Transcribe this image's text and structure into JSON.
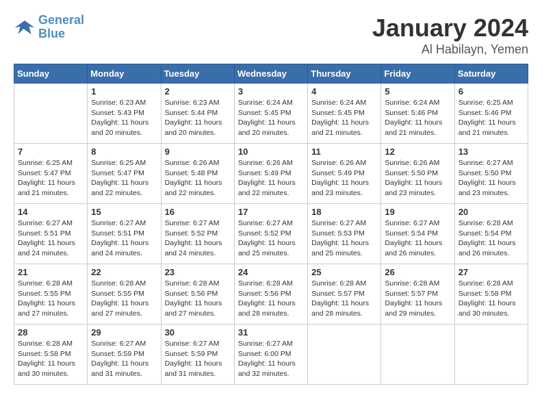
{
  "header": {
    "logo_line1": "General",
    "logo_line2": "Blue",
    "title": "January 2024",
    "subtitle": "Al Habilayn, Yemen"
  },
  "weekdays": [
    "Sunday",
    "Monday",
    "Tuesday",
    "Wednesday",
    "Thursday",
    "Friday",
    "Saturday"
  ],
  "weeks": [
    [
      {
        "day": "",
        "sunrise": "",
        "sunset": "",
        "daylight": ""
      },
      {
        "day": "1",
        "sunrise": "Sunrise: 6:23 AM",
        "sunset": "Sunset: 5:43 PM",
        "daylight": "Daylight: 11 hours and 20 minutes."
      },
      {
        "day": "2",
        "sunrise": "Sunrise: 6:23 AM",
        "sunset": "Sunset: 5:44 PM",
        "daylight": "Daylight: 11 hours and 20 minutes."
      },
      {
        "day": "3",
        "sunrise": "Sunrise: 6:24 AM",
        "sunset": "Sunset: 5:45 PM",
        "daylight": "Daylight: 11 hours and 20 minutes."
      },
      {
        "day": "4",
        "sunrise": "Sunrise: 6:24 AM",
        "sunset": "Sunset: 5:45 PM",
        "daylight": "Daylight: 11 hours and 21 minutes."
      },
      {
        "day": "5",
        "sunrise": "Sunrise: 6:24 AM",
        "sunset": "Sunset: 5:46 PM",
        "daylight": "Daylight: 11 hours and 21 minutes."
      },
      {
        "day": "6",
        "sunrise": "Sunrise: 6:25 AM",
        "sunset": "Sunset: 5:46 PM",
        "daylight": "Daylight: 11 hours and 21 minutes."
      }
    ],
    [
      {
        "day": "7",
        "sunrise": "Sunrise: 6:25 AM",
        "sunset": "Sunset: 5:47 PM",
        "daylight": "Daylight: 11 hours and 21 minutes."
      },
      {
        "day": "8",
        "sunrise": "Sunrise: 6:25 AM",
        "sunset": "Sunset: 5:47 PM",
        "daylight": "Daylight: 11 hours and 22 minutes."
      },
      {
        "day": "9",
        "sunrise": "Sunrise: 6:26 AM",
        "sunset": "Sunset: 5:48 PM",
        "daylight": "Daylight: 11 hours and 22 minutes."
      },
      {
        "day": "10",
        "sunrise": "Sunrise: 6:26 AM",
        "sunset": "Sunset: 5:49 PM",
        "daylight": "Daylight: 11 hours and 22 minutes."
      },
      {
        "day": "11",
        "sunrise": "Sunrise: 6:26 AM",
        "sunset": "Sunset: 5:49 PM",
        "daylight": "Daylight: 11 hours and 23 minutes."
      },
      {
        "day": "12",
        "sunrise": "Sunrise: 6:26 AM",
        "sunset": "Sunset: 5:50 PM",
        "daylight": "Daylight: 11 hours and 23 minutes."
      },
      {
        "day": "13",
        "sunrise": "Sunrise: 6:27 AM",
        "sunset": "Sunset: 5:50 PM",
        "daylight": "Daylight: 11 hours and 23 minutes."
      }
    ],
    [
      {
        "day": "14",
        "sunrise": "Sunrise: 6:27 AM",
        "sunset": "Sunset: 5:51 PM",
        "daylight": "Daylight: 11 hours and 24 minutes."
      },
      {
        "day": "15",
        "sunrise": "Sunrise: 6:27 AM",
        "sunset": "Sunset: 5:51 PM",
        "daylight": "Daylight: 11 hours and 24 minutes."
      },
      {
        "day": "16",
        "sunrise": "Sunrise: 6:27 AM",
        "sunset": "Sunset: 5:52 PM",
        "daylight": "Daylight: 11 hours and 24 minutes."
      },
      {
        "day": "17",
        "sunrise": "Sunrise: 6:27 AM",
        "sunset": "Sunset: 5:52 PM",
        "daylight": "Daylight: 11 hours and 25 minutes."
      },
      {
        "day": "18",
        "sunrise": "Sunrise: 6:27 AM",
        "sunset": "Sunset: 5:53 PM",
        "daylight": "Daylight: 11 hours and 25 minutes."
      },
      {
        "day": "19",
        "sunrise": "Sunrise: 6:27 AM",
        "sunset": "Sunset: 5:54 PM",
        "daylight": "Daylight: 11 hours and 26 minutes."
      },
      {
        "day": "20",
        "sunrise": "Sunrise: 6:28 AM",
        "sunset": "Sunset: 5:54 PM",
        "daylight": "Daylight: 11 hours and 26 minutes."
      }
    ],
    [
      {
        "day": "21",
        "sunrise": "Sunrise: 6:28 AM",
        "sunset": "Sunset: 5:55 PM",
        "daylight": "Daylight: 11 hours and 27 minutes."
      },
      {
        "day": "22",
        "sunrise": "Sunrise: 6:28 AM",
        "sunset": "Sunset: 5:55 PM",
        "daylight": "Daylight: 11 hours and 27 minutes."
      },
      {
        "day": "23",
        "sunrise": "Sunrise: 6:28 AM",
        "sunset": "Sunset: 5:56 PM",
        "daylight": "Daylight: 11 hours and 27 minutes."
      },
      {
        "day": "24",
        "sunrise": "Sunrise: 6:28 AM",
        "sunset": "Sunset: 5:56 PM",
        "daylight": "Daylight: 11 hours and 28 minutes."
      },
      {
        "day": "25",
        "sunrise": "Sunrise: 6:28 AM",
        "sunset": "Sunset: 5:57 PM",
        "daylight": "Daylight: 11 hours and 28 minutes."
      },
      {
        "day": "26",
        "sunrise": "Sunrise: 6:28 AM",
        "sunset": "Sunset: 5:57 PM",
        "daylight": "Daylight: 11 hours and 29 minutes."
      },
      {
        "day": "27",
        "sunrise": "Sunrise: 6:28 AM",
        "sunset": "Sunset: 5:58 PM",
        "daylight": "Daylight: 11 hours and 30 minutes."
      }
    ],
    [
      {
        "day": "28",
        "sunrise": "Sunrise: 6:28 AM",
        "sunset": "Sunset: 5:58 PM",
        "daylight": "Daylight: 11 hours and 30 minutes."
      },
      {
        "day": "29",
        "sunrise": "Sunrise: 6:27 AM",
        "sunset": "Sunset: 5:59 PM",
        "daylight": "Daylight: 11 hours and 31 minutes."
      },
      {
        "day": "30",
        "sunrise": "Sunrise: 6:27 AM",
        "sunset": "Sunset: 5:59 PM",
        "daylight": "Daylight: 11 hours and 31 minutes."
      },
      {
        "day": "31",
        "sunrise": "Sunrise: 6:27 AM",
        "sunset": "Sunset: 6:00 PM",
        "daylight": "Daylight: 11 hours and 32 minutes."
      },
      {
        "day": "",
        "sunrise": "",
        "sunset": "",
        "daylight": ""
      },
      {
        "day": "",
        "sunrise": "",
        "sunset": "",
        "daylight": ""
      },
      {
        "day": "",
        "sunrise": "",
        "sunset": "",
        "daylight": ""
      }
    ]
  ]
}
